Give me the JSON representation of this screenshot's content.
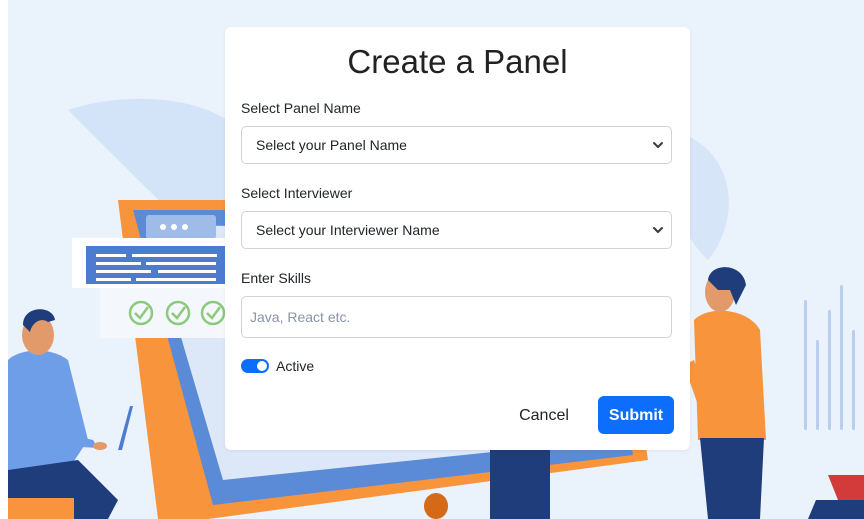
{
  "modal": {
    "title": "Create a Panel",
    "panel_name": {
      "label": "Select Panel Name",
      "selected": "Select your Panel Name"
    },
    "interviewer": {
      "label": "Select Interviewer",
      "selected": "Select your Interviewer Name"
    },
    "skills": {
      "label": "Enter Skills",
      "value": "",
      "placeholder": "Java, React etc."
    },
    "active_toggle": {
      "label": "Active",
      "on": true
    },
    "cancel_label": "Cancel",
    "submit_label": "Submit"
  },
  "colors": {
    "primary": "#0d6efd",
    "background": "#eaf2fb",
    "illustration_orange": "#f7943c",
    "illustration_navy": "#1e3d7a",
    "illustration_blue": "#5b8bd6"
  }
}
